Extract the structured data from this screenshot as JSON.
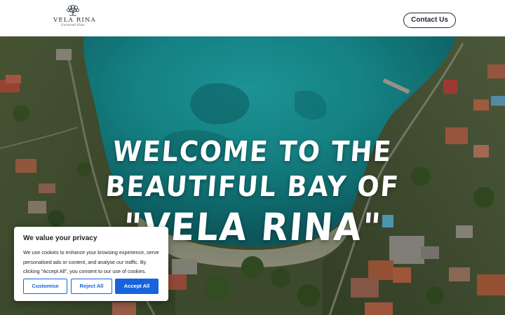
{
  "header": {
    "logo": {
      "name": "VELA RINA",
      "tagline": "Gurmond Hote"
    },
    "contact_label": "Contact Us"
  },
  "hero": {
    "title_line1": "WELCOME TO THE",
    "title_line2": "BEAUTIFUL BAY OF",
    "title_line3": "\"VELA RINA\""
  },
  "cookie_banner": {
    "title": "We value your privacy",
    "text": "We use cookies to enhance your browsing experience, serve personalised ads or content, and analyse our traffic. By clicking \"Accept All\", you consent to our use of cookies.",
    "customise_label": "Customise",
    "reject_label": "Reject All",
    "accept_label": "Accept All"
  },
  "colors": {
    "primary_blue": "#1863dc",
    "dark_text": "#1f2a36",
    "sea": "#1fa3a5"
  }
}
